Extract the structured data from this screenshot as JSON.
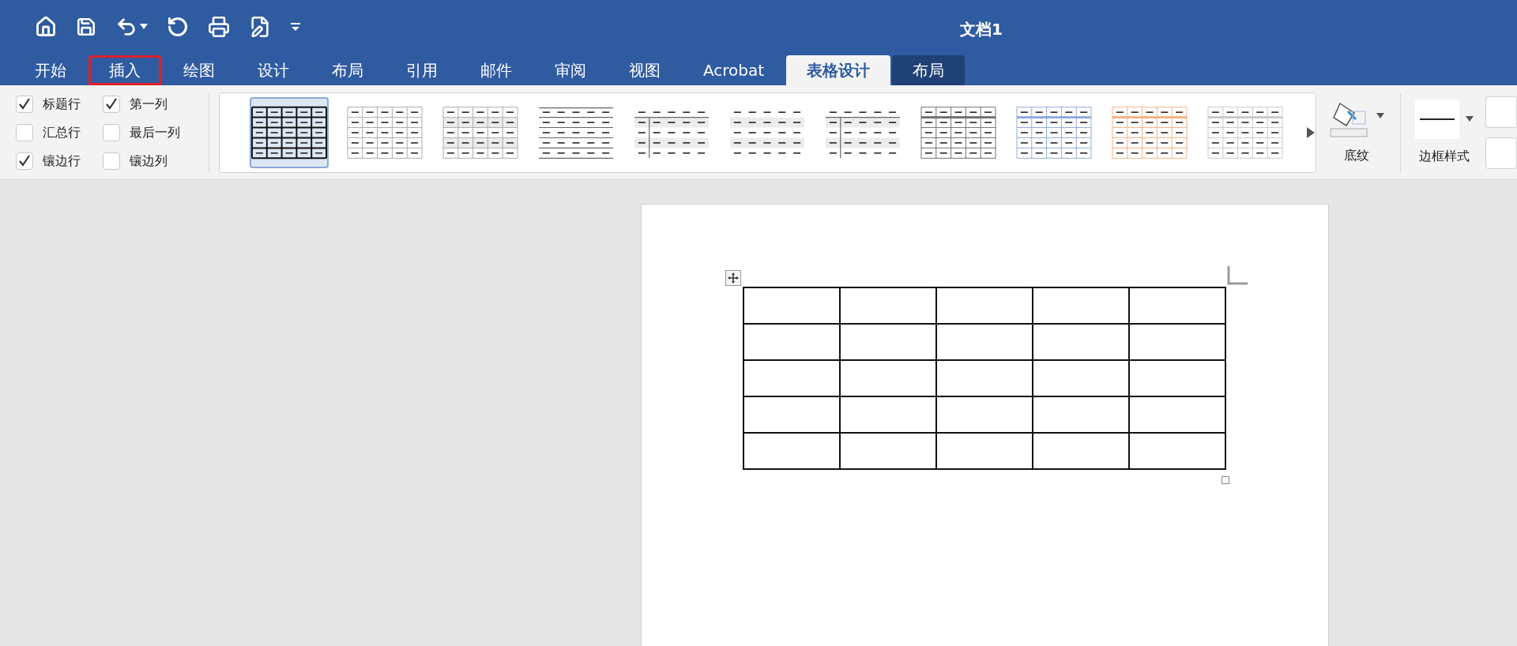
{
  "window": {
    "title": "文档1"
  },
  "tabs": [
    {
      "label": "开始",
      "selected": false,
      "kind": "normal",
      "outlined": false
    },
    {
      "label": "插入",
      "selected": false,
      "kind": "normal",
      "outlined": true
    },
    {
      "label": "绘图",
      "selected": false,
      "kind": "normal",
      "outlined": false
    },
    {
      "label": "设计",
      "selected": false,
      "kind": "normal",
      "outlined": false
    },
    {
      "label": "布局",
      "selected": false,
      "kind": "normal",
      "outlined": false
    },
    {
      "label": "引用",
      "selected": false,
      "kind": "normal",
      "outlined": false
    },
    {
      "label": "邮件",
      "selected": false,
      "kind": "normal",
      "outlined": false
    },
    {
      "label": "审阅",
      "selected": false,
      "kind": "normal",
      "outlined": false
    },
    {
      "label": "视图",
      "selected": false,
      "kind": "normal",
      "outlined": false
    },
    {
      "label": "Acrobat",
      "selected": false,
      "kind": "normal",
      "outlined": false
    },
    {
      "label": "表格设计",
      "selected": true,
      "kind": "contextual",
      "outlined": false
    },
    {
      "label": "布局",
      "selected": false,
      "kind": "contextual",
      "outlined": false
    }
  ],
  "options": [
    {
      "label": "标题行",
      "checked": true
    },
    {
      "label": "第一列",
      "checked": true
    },
    {
      "label": "汇总行",
      "checked": false
    },
    {
      "label": "最后一列",
      "checked": false
    },
    {
      "label": "镶边行",
      "checked": true
    },
    {
      "label": "镶边列",
      "checked": false
    }
  ],
  "table_styles": [
    {
      "kind": "grid-bold",
      "selected": true
    },
    {
      "kind": "grid-light",
      "selected": false
    },
    {
      "kind": "grid-banded",
      "selected": false
    },
    {
      "kind": "lines",
      "selected": false
    },
    {
      "kind": "first-col",
      "selected": false
    },
    {
      "kind": "dashes-banded",
      "selected": false
    },
    {
      "kind": "first-col",
      "selected": false
    },
    {
      "kind": "header-grid",
      "selected": false,
      "color": "#707070"
    },
    {
      "kind": "header-grid",
      "selected": false,
      "color": "#8eaadb"
    },
    {
      "kind": "header-grid",
      "selected": false,
      "color": "#f4b183"
    },
    {
      "kind": "header-grid",
      "selected": false,
      "color": "#c9c9c9"
    }
  ],
  "shading": {
    "label": "底纹"
  },
  "border_style": {
    "label": "边框样式"
  }
}
